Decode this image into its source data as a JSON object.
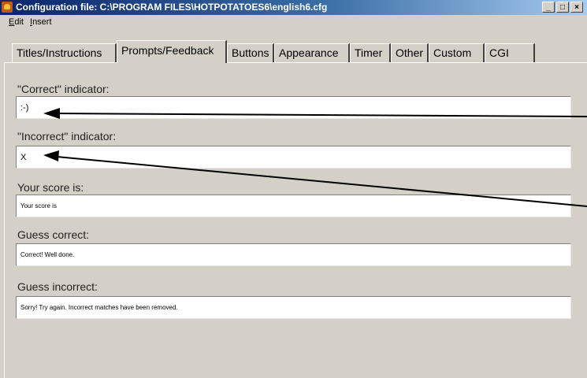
{
  "window": {
    "title": "Configuration file: C:\\PROGRAM FILES\\HOTPOTATOES6\\english6.cfg",
    "buttons": {
      "minimize": "_",
      "maximize": "□",
      "close": "×"
    }
  },
  "menu": [
    {
      "first": "E",
      "rest": "dit"
    },
    {
      "first": "I",
      "rest": "nsert"
    }
  ],
  "tabs": [
    "Titles/Instructions",
    "Prompts/Feedback",
    "Buttons",
    "Appearance",
    "Timer",
    "Other",
    "Custom",
    "CGI"
  ],
  "active_tab": "Prompts/Feedback",
  "fields": {
    "correct_indicator": {
      "label": "\"Correct\" indicator:",
      "value": ":-)"
    },
    "incorrect_indicator": {
      "label": "\"Incorrect\" indicator:",
      "value": "X"
    },
    "your_score": {
      "label": "Your score is:",
      "value": "Your score is"
    },
    "guess_correct": {
      "label": "Guess correct:",
      "value": "Correct! Well done."
    },
    "guess_incorrect": {
      "label": "Guess incorrect:",
      "value": "Sorry! Try again. Incorrect matches have been removed."
    }
  },
  "colors": {
    "titlebar_start": "#0a246a",
    "titlebar_end": "#a6caf0",
    "face": "#d4d0c8"
  }
}
